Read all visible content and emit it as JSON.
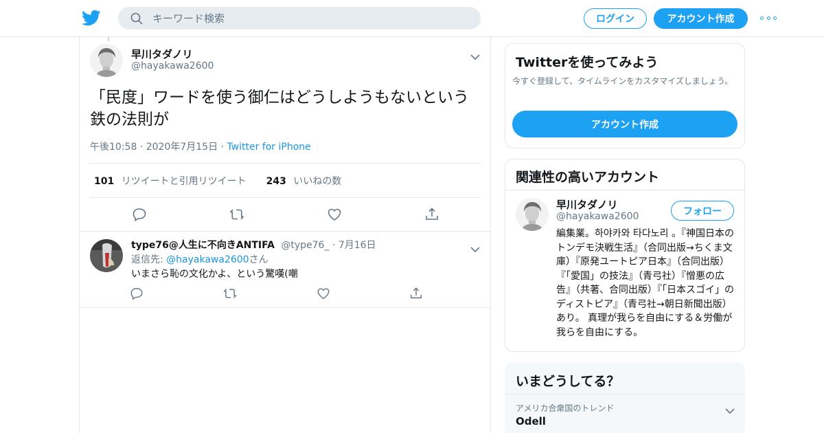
{
  "header": {
    "search_placeholder": "キーワード検索",
    "login_label": "ログイン",
    "signup_label": "アカウント作成"
  },
  "tweet": {
    "name": "早川タダノリ",
    "handle": "@hayakawa2600",
    "text": "「民度」ワードを使う御仁はどうしようもないという鉄の法則が",
    "time": "午後10:58",
    "date": "2020年7月15日",
    "source": "Twitter for iPhone",
    "retweets_count": "101",
    "retweets_label": "リツイートと引用リツイート",
    "likes_count": "243",
    "likes_label": "いいねの数"
  },
  "reply": {
    "name": "type76@人生に不向きANTIFA",
    "handle": "@type76_",
    "date": "7月16日",
    "reply_to_prefix": "返信先: ",
    "reply_to_mention": "@hayakawa2600",
    "reply_to_suffix": "さん",
    "text": "いまさら恥の文化かよ、という驚嘆(嘲"
  },
  "signup_card": {
    "title": "Twitterを使ってみよう",
    "description": "今すぐ登録して、タイムラインをカスタマイズしましょう。",
    "button_label": "アカウント作成"
  },
  "related_card": {
    "title": "関連性の高いアカウント",
    "name": "早川タダノリ",
    "handle": "@hayakawa2600",
    "follow_label": "フォロー",
    "bio": "編集業。하야카와 타다노리 。『神国日本のトンデモ決戦生活』（合同出版→ちくま文庫）『原発ユートピア日本』（合同出版）『「愛国」の技法』（青弓社）『憎悪の広告』（共著、合同出版）『「日本スゴイ」のディストピア』（青弓社→朝日新聞出版）あり。 真理が我らを自由にする＆労働が我らを自由にする。"
  },
  "trends_card": {
    "title": "いまどうしてる？",
    "context": "アメリカ合衆国のトレンド",
    "trend": "Odell"
  },
  "colors": {
    "accent": "#1da1f2",
    "link": "#1b95e0",
    "secondary_text": "#657786",
    "border": "#e1e8ed"
  }
}
